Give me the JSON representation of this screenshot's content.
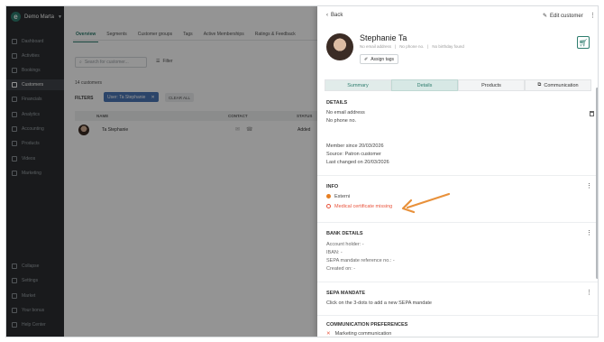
{
  "colors": {
    "accent": "#2e7d6e",
    "sidebar_bg": "#2b2e31",
    "warning": "#e8533b",
    "status_orange": "#e67e22",
    "chip_blue": "#4a76b6",
    "annotation_arrow": "#e8913b"
  },
  "sidebar": {
    "account_name": "Demo Marta",
    "logo_letter": "e",
    "items": [
      {
        "label": "Dashboard",
        "icon": "dashboard-icon"
      },
      {
        "label": "Activities",
        "icon": "activities-icon"
      },
      {
        "label": "Bookings",
        "icon": "calendar-icon"
      },
      {
        "label": "Customers",
        "icon": "user-icon",
        "active": true
      },
      {
        "label": "Financials",
        "icon": "euro-icon"
      },
      {
        "label": "Analytics",
        "icon": "chart-icon"
      },
      {
        "label": "Accounting",
        "icon": "accounting-icon"
      },
      {
        "label": "Products",
        "icon": "box-icon"
      },
      {
        "label": "Videos",
        "icon": "play-icon"
      },
      {
        "label": "Marketing",
        "icon": "megaphone-icon"
      }
    ],
    "bottom_items": [
      {
        "label": "Collapse",
        "icon": "collapse-icon"
      },
      {
        "label": "Settings",
        "icon": "gear-icon"
      },
      {
        "label": "Market",
        "icon": "grid-icon"
      },
      {
        "label": "Your bonus",
        "icon": "heart-icon"
      },
      {
        "label": "Help Center",
        "icon": "help-icon"
      }
    ]
  },
  "main": {
    "tabs": [
      "Overview",
      "Segments",
      "Customer groups",
      "Tags",
      "Active Memberships",
      "Ratings & Feedback"
    ],
    "search_placeholder": "Search for customer...",
    "filter_label": "Filter",
    "count_text": "14 customers",
    "filters_label": "FILTERS",
    "filter_chip": "User: Ta Stephanie",
    "clear_all": "CLEAR ALL",
    "columns": [
      "NAME",
      "CONTACT",
      "STATUS"
    ],
    "rows": [
      {
        "name": "Ta Stephanie",
        "status": "Added"
      }
    ]
  },
  "panel": {
    "back_label": "Back",
    "edit_label": "Edit customer",
    "name": "Stephanie Ta",
    "meta": [
      "No email address",
      "No phone no.",
      "No birthday found"
    ],
    "assign_tags": "Assign tags",
    "tabs": [
      "Summary",
      "Details",
      "Products",
      "Communication"
    ],
    "details": {
      "title": "DETAILS",
      "email": "No email address",
      "phone": "No phone no.",
      "member_since": "Member since 20/03/2026",
      "source": "Source: Patron customer",
      "last_changed": "Last changed on 20/03/2026"
    },
    "info": {
      "title": "INFO",
      "status": "Esterni",
      "warning": "Medical certificate missing"
    },
    "bank": {
      "title": "BANK DETAILS",
      "lines": [
        "Account holder: -",
        "IBAN: -",
        "SEPA mandate reference no.: -",
        "Created on: -"
      ]
    },
    "sepa": {
      "title": "SEPA MANDATE",
      "text": "Click on the 3-dots to add a new SEPA mandate"
    },
    "comm": {
      "title": "COMMUNICATION PREFERENCES",
      "item": "Marketing communication"
    }
  }
}
